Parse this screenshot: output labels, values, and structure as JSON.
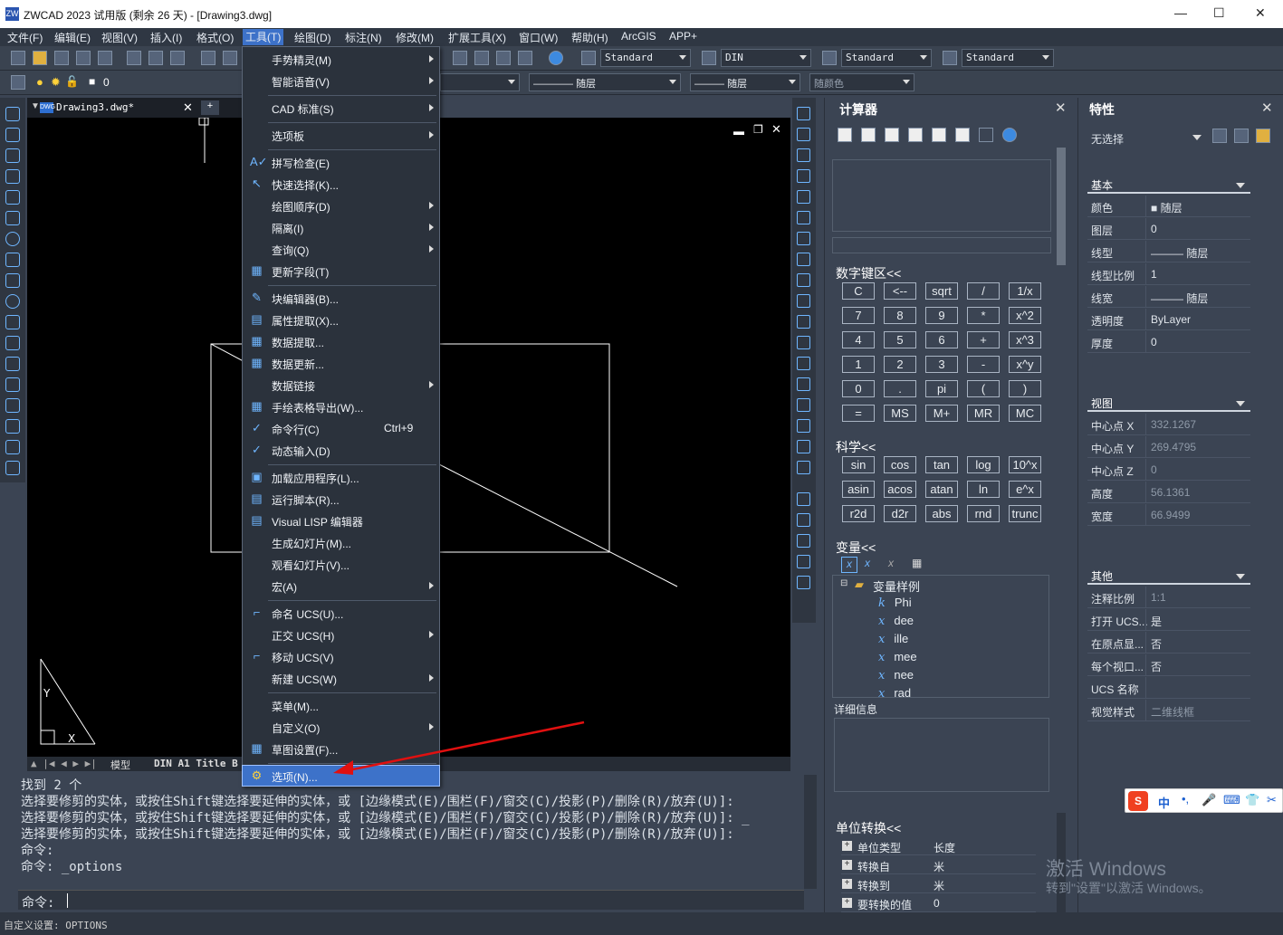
{
  "titlebar": {
    "title": "ZWCAD 2023 试用版 (剩余 26 天) - [Drawing3.dwg]",
    "min": "—",
    "max": "☐",
    "close": "✕"
  },
  "menubar": [
    "文件(F)",
    "编辑(E)",
    "视图(V)",
    "插入(I)",
    "格式(O)",
    "工具(T)",
    "绘图(D)",
    "标注(N)",
    "修改(M)",
    "扩展工具(X)",
    "窗口(W)",
    "帮助(H)",
    "ArcGIS",
    "APP+"
  ],
  "toolbar": {
    "text_style": "Standard",
    "dim_style": "DIN",
    "table_style": "Standard",
    "mleader_style": "Standard",
    "layer_value": "0",
    "linetype": "随层",
    "lineweight": "随层",
    "color": "随层",
    "plotstyle": "随颜色"
  },
  "doc": {
    "tab": "Drawing3.dwg*",
    "model_tab": "模型",
    "layout_tab": "DIN A1 Title B"
  },
  "dropdown": [
    {
      "label": "手势精灵(M)",
      "sub": true
    },
    {
      "label": "智能语音(V)",
      "sub": true
    },
    {
      "label": "CAD 标准(S)",
      "sub": true
    },
    {
      "label": "选项板",
      "sub": true
    },
    {
      "label": "拼写检查(E)"
    },
    {
      "label": "快速选择(K)..."
    },
    {
      "label": "绘图顺序(D)",
      "sub": true
    },
    {
      "label": "隔离(I)",
      "sub": true
    },
    {
      "label": "查询(Q)",
      "sub": true
    },
    {
      "label": "更新字段(T)"
    },
    {
      "label": "块编辑器(B)..."
    },
    {
      "label": "属性提取(X)..."
    },
    {
      "label": "数据提取..."
    },
    {
      "label": "数据更新..."
    },
    {
      "label": "数据链接",
      "sub": true
    },
    {
      "label": "手绘表格导出(W)..."
    },
    {
      "label": "命令行(C)",
      "shortcut": "Ctrl+9"
    },
    {
      "label": "动态输入(D)"
    },
    {
      "label": "加载应用程序(L)..."
    },
    {
      "label": "运行脚本(R)..."
    },
    {
      "label": "Visual LISP 编辑器"
    },
    {
      "label": "生成幻灯片(M)..."
    },
    {
      "label": "观看幻灯片(V)..."
    },
    {
      "label": "宏(A)",
      "sub": true
    },
    {
      "label": "命名 UCS(U)..."
    },
    {
      "label": "正交 UCS(H)",
      "sub": true
    },
    {
      "label": "移动 UCS(V)"
    },
    {
      "label": "新建 UCS(W)",
      "sub": true
    },
    {
      "label": "菜单(M)..."
    },
    {
      "label": "自定义(O)",
      "sub": true
    },
    {
      "label": "草图设置(F)..."
    },
    {
      "label": "选项(N)..."
    }
  ],
  "command": {
    "lines": [
      "找到 2 个",
      "选择要修剪的实体，或按住Shift键选择要延伸的实体，或 [边缘模式(E)/围栏(F)/窗交(C)/投影(P)/删除(R)/放弃(U)]:",
      "选择要修剪的实体，或按住Shift键选择要延伸的实体，或 [边缘模式(E)/围栏(F)/窗交(C)/投影(P)/删除(R)/放弃(U)]: _",
      "选择要修剪的实体，或按住Shift键选择要延伸的实体，或 [边缘模式(E)/围栏(F)/窗交(C)/投影(P)/删除(R)/放弃(U)]:",
      "命令:",
      "命令: _options"
    ],
    "prompt": "命令:"
  },
  "status": "自定义设置: OPTIONS",
  "calc": {
    "title": "计算器",
    "numpad_title": "数字键区<<",
    "keys": [
      [
        "C",
        "<--",
        "sqrt",
        "/",
        "1/x"
      ],
      [
        "7",
        "8",
        "9",
        "*",
        "x^2"
      ],
      [
        "4",
        "5",
        "6",
        "+",
        "x^3"
      ],
      [
        "1",
        "2",
        "3",
        "-",
        "x^y"
      ],
      [
        "0",
        ".",
        "pi",
        "(",
        ")"
      ],
      [
        "=",
        "MS",
        "M+",
        "MR",
        "MC"
      ]
    ],
    "sci_title": "科学<<",
    "sci": [
      [
        "sin",
        "cos",
        "tan",
        "log",
        "10^x"
      ],
      [
        "asin",
        "acos",
        "atan",
        "ln",
        "e^x"
      ],
      [
        "r2d",
        "d2r",
        "abs",
        "rnd",
        "trunc"
      ]
    ],
    "var_title": "变量<<",
    "var_root": "变量样例",
    "vars": [
      {
        "t": "k",
        "n": "Phi"
      },
      {
        "t": "x",
        "n": "dee"
      },
      {
        "t": "x",
        "n": "ille"
      },
      {
        "t": "x",
        "n": "mee"
      },
      {
        "t": "x",
        "n": "nee"
      },
      {
        "t": "x",
        "n": "rad"
      }
    ],
    "detail": "详细信息",
    "unit_title": "单位转换<<",
    "units": [
      {
        "k": "单位类型",
        "v": "长度"
      },
      {
        "k": "转换自",
        "v": "米"
      },
      {
        "k": "转换到",
        "v": "米"
      },
      {
        "k": "要转换的值",
        "v": "0"
      }
    ]
  },
  "props": {
    "title": "特性",
    "selection": "无选择",
    "groups": [
      {
        "name": "基本",
        "rows": [
          {
            "k": "颜色",
            "v": "■ 随层"
          },
          {
            "k": "图层",
            "v": "0"
          },
          {
            "k": "线型",
            "v": "——— 随层"
          },
          {
            "k": "线型比例",
            "v": "1"
          },
          {
            "k": "线宽",
            "v": "——— 随层"
          },
          {
            "k": "透明度",
            "v": "ByLayer"
          },
          {
            "k": "厚度",
            "v": "0"
          }
        ]
      },
      {
        "name": "视图",
        "rows": [
          {
            "k": "中心点 X",
            "v": "332.1267",
            "dim": true
          },
          {
            "k": "中心点 Y",
            "v": "269.4795",
            "dim": true
          },
          {
            "k": "中心点 Z",
            "v": "0",
            "dim": true
          },
          {
            "k": "高度",
            "v": "56.1361",
            "dim": true
          },
          {
            "k": "宽度",
            "v": "66.9499",
            "dim": true
          }
        ]
      },
      {
        "name": "其他",
        "rows": [
          {
            "k": "注释比例",
            "v": "1:1",
            "dim": true
          },
          {
            "k": "打开 UCS...",
            "v": "是"
          },
          {
            "k": "在原点显...",
            "v": "否"
          },
          {
            "k": "每个视口...",
            "v": "否"
          },
          {
            "k": "UCS 名称",
            "v": ""
          },
          {
            "k": "视觉样式",
            "v": "二维线框",
            "dim": true
          }
        ]
      }
    ]
  },
  "watermark": {
    "line1": "激活 Windows",
    "line2": "转到\"设置\"以激活 Windows。"
  },
  "ime": {
    "items": [
      "中",
      "•,",
      "🎤",
      "⌨",
      "👕",
      "✂"
    ]
  }
}
